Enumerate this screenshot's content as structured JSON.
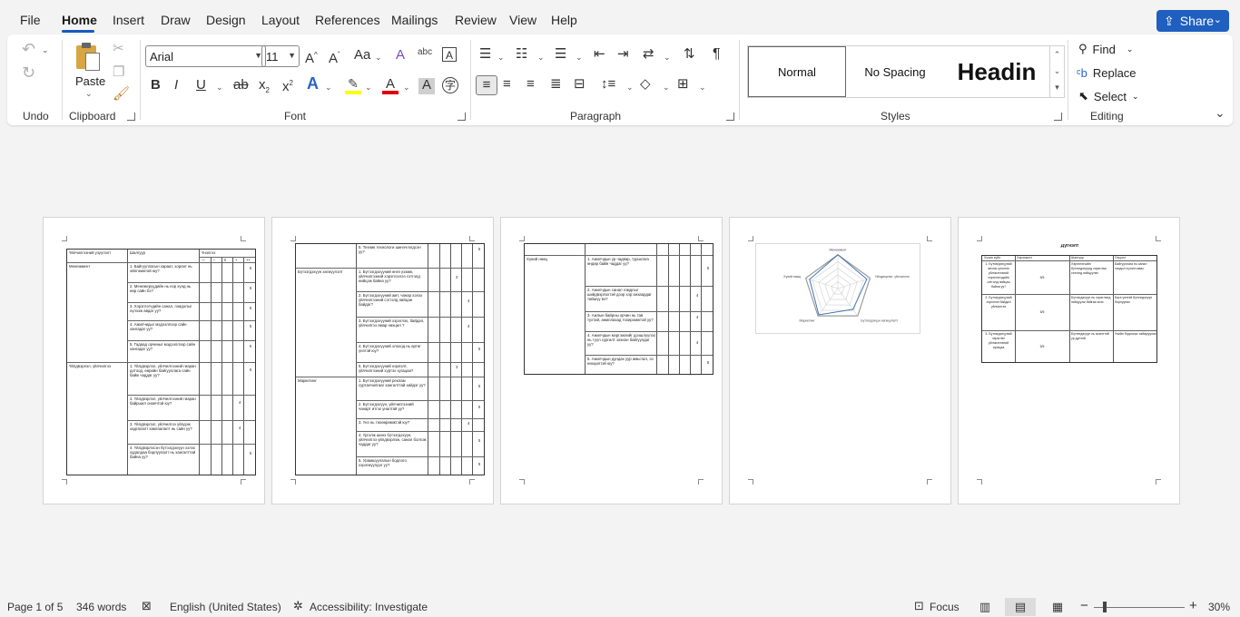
{
  "menu": {
    "items": [
      "File",
      "Home",
      "Insert",
      "Draw",
      "Design",
      "Layout",
      "References",
      "Mailings",
      "Review",
      "View",
      "Help"
    ],
    "share_label": "Share"
  },
  "ribbon": {
    "groups": {
      "undo": "Undo",
      "clipboard": "Clipboard",
      "font": "Font",
      "paragraph": "Paragraph",
      "styles": "Styles",
      "editing": "Editing"
    },
    "paste_label": "Paste",
    "font_name": "Arial",
    "font_size": "11",
    "styles": [
      "Normal",
      "No Spacing",
      "Headin"
    ],
    "find_label": "Find",
    "replace_label": "Replace",
    "select_label": "Select",
    "colors": {
      "highlight": "#ffff00",
      "font_color": "#e00000",
      "accent": "#185abd"
    }
  },
  "pages": {
    "p1": {
      "headers": [
        "Үйлчилгээний үзүүлэлт",
        "Шалгуур",
        "Үнэлгээ"
      ],
      "scale": [
        "—",
        "–",
        "0",
        "+",
        "++"
      ],
      "sections": [
        "Менежмент",
        "Үйлдвэрлэл, үйлчилгээ"
      ],
      "rows": [
        {
          "text": "1. Байгууллагын хараат, хорлит нь ойлгомжтой юу?",
          "score": "5"
        },
        {
          "text": "2. Менежерүүдийн нь нэр хүнд нь өөр сайн бэ?",
          "score": "5"
        },
        {
          "text": "3. Хэрэглэгчдийн санал, гомдолыг хүлээж авдаг уу?",
          "score": "5"
        },
        {
          "text": "4. Ажилчидыг мэдээллээр сайн хангадаг уу?",
          "score": "5"
        },
        {
          "text": "5. Гадаад орчиныг мэдээллээр сайн хангадаг уу?",
          "score": "5"
        },
        {
          "text": "1. Үйлдвэрлэл, үйлчилгээний гиаран дотоод, өөрийн байгууллага сайн байж чаддаг уу?",
          "score": "5"
        },
        {
          "text": "2. Үйлдвэрлэл, үйлчилгээний гиаран байршил оновчтой юу?",
          "score": "4"
        },
        {
          "text": "3. Үйлдвэрлэл, үйлчилгээ үйлдэж хадгалалт хамгаалалт нь сайн уу?",
          "score": "4"
        },
        {
          "text": "4. Үйлдвэрлэсэн бүтээгдэхүүн хэлэх худалдаа борлуулалт нь хангалттай байна уу?",
          "score": "5"
        }
      ]
    },
    "p2": {
      "sections": [
        "Бүтээгдэхүүн хөгжүүлэлт",
        "Маркетинг"
      ],
      "rows": [
        {
          "text": "5. Техник технологи шинэчлэгдсэн уу?",
          "score": "5"
        },
        {
          "text": "1. Бүтээгдэхүүний өнгө үзэмж, үйлчилгээний хэрэглээгээ сэтгэлд нийцэж байна уу?",
          "score": "3"
        },
        {
          "text": "2. Бүтээгдэхүүний амт, чанар хэлэх үйлчилгээний сэтгэлд нийцэж байдаг?",
          "score": "4"
        },
        {
          "text": "3. Бүтээгдэхүүний хэрэглэх, байдал, үйлчилгээ ямар нөхцөл ?",
          "score": "4"
        },
        {
          "text": "4. Бүтээгдэхүүний олоход нь өртөг үнэтэй юу?",
          "score": "5"
        },
        {
          "text": "5. Бүтээгдэхүүний нэрлэлт, үйлчилгээний хүртэх хугацаа?",
          "score": "3"
        },
        {
          "text": "1. Бүтээгдэхүүний реклам сурталчилгааг хангалттай хийдэг уу?",
          "score": "5"
        },
        {
          "text": "2. Бүтээгдэхүүн, үйлчилгээний чанарт итгэх уналтай уу?",
          "score": "5"
        },
        {
          "text": "3. Үнэ нь төхөөрөмжтэй юу?",
          "score": "4"
        },
        {
          "text": "4. Үргэлж шинэ бүтээгдэхүүн, үйлчилгээ үйлдвэрлэж, санал болгож чаддаг уу?",
          "score": "5"
        },
        {
          "text": "5. Урамшуулалын бодлого хэрэгжүүлдэг уу?",
          "score": "5"
        }
      ]
    },
    "p3": {
      "sections": [
        "Хүний нөөц"
      ],
      "rows": [
        {
          "text": "1. Ажилчдын үр чадвар, туршлага өндөр байж чаддаг уу?",
          "score": "5"
        },
        {
          "text": "2. Ажилчдын санал гомдлыг шийдвэрлэхтэй дээр хэр анхаардаг тийшүү вэ?",
          "score": "4"
        },
        {
          "text": "3. Ажлын байрны орчин нь тав тухтай, ажиллахад тохиромжтой уу?",
          "score": "4"
        },
        {
          "text": "4. Ажилчдын мэргэжлийг дээшлүүлэх нь түүл сургалт зохион байгуулдаг уу?",
          "score": "4"
        },
        {
          "text": "5. Ажилчдын дундах уур амьсгал, ээ нөхцөлтэй юу?",
          "score": "5"
        }
      ]
    },
    "p4": {
      "chart_data": {
        "type": "radar",
        "title": "",
        "categories": [
          "Менежмент",
          "Үйлдвэрлэл, үйлчилгээ",
          "Бүтээгдэхүүн хөгжүүлэлт",
          "Маркетинг",
          "Хүний нөөц"
        ],
        "series": [
          {
            "values": [
              5,
              4.5,
              3.8,
              4.8,
              4.4
            ]
          }
        ],
        "rlim": [
          0,
          5
        ]
      }
    },
    "p5": {
      "title": "Дүгнэлт",
      "headers": [
        "Хүчин зүйл",
        "Хэрэгжилт",
        "Шалгуур",
        "Онцлог"
      ],
      "rows": [
        {
          "a": "1. Бүтээгдэхүүний анхны үнэлгээ үйлчилгээний хэрэглэгчдийн сэтгэлд нийцэж байна уу?",
          "b": "5/5",
          "c": "Хэрэглэгчийн бүтээгдэхүүнд хэрэглэж сэтгэлд нийцүүлэх",
          "d": "Байгууллага нь санал гомдол хүлээн авах"
        },
        {
          "a": "2. Бүтээгдэхүүний хэрэглэл байдал үйлчилгээ",
          "b": "5/5",
          "c": "Бүтээгдэхүүн нь хэрэглэлд нийцүүлж байгаа эсэх",
          "d": "Бага үнэтэй бүтээгдэхүүн борлуулах"
        },
        {
          "a": "3. Бүтээгдэхүүний хэрэглэх үйлчилгээний хугацаа",
          "b": "5/5",
          "c": "Бүтээгдэхүүн нь өсөлттэй үр дүнтэй",
          "d": "Үнийн бодлогыг сайжруулах"
        }
      ]
    }
  },
  "status": {
    "page": "Page 1 of 5",
    "words": "346 words",
    "language": "English (United States)",
    "accessibility": "Accessibility: Investigate",
    "focus": "Focus",
    "zoom": "30%"
  }
}
